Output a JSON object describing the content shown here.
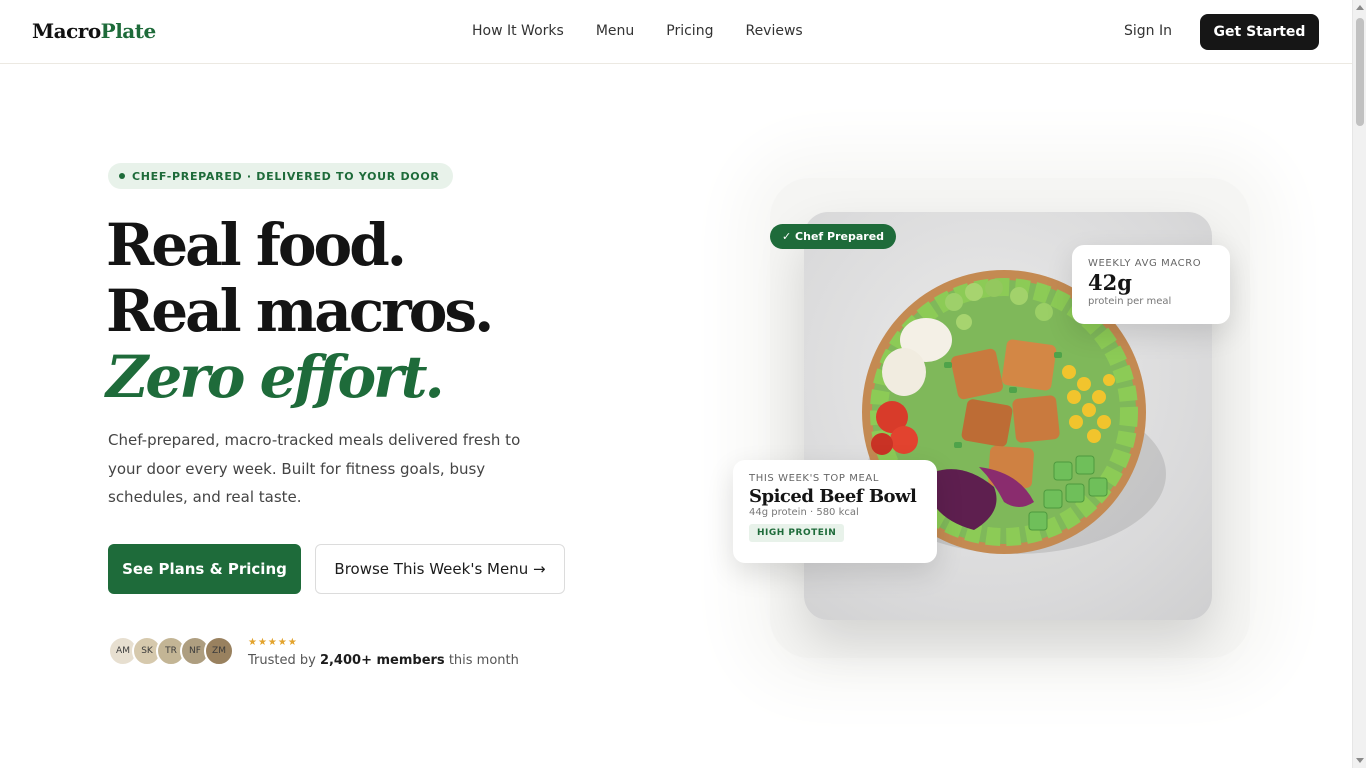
{
  "header": {
    "logo_part1": "Macro",
    "logo_part2": "Plate",
    "nav": [
      "How It Works",
      "Menu",
      "Pricing",
      "Reviews"
    ],
    "signin_label": "Sign In",
    "cta_label": "Get Started"
  },
  "hero": {
    "eyebrow": "CHEF-PREPARED · DELIVERED TO YOUR DOOR",
    "headline_line1": "Real food.",
    "headline_line2": "Real macros.",
    "headline_line3": "Zero effort.",
    "lede": "Chef-prepared, macro-tracked meals delivered fresh to your door every week. Built for fitness goals, busy schedules, and real taste.",
    "primary_cta": "See Plans & Pricing",
    "secondary_cta": "Browse This Week's Menu →",
    "avatars": [
      {
        "initials": "AM",
        "color": "#e7dfd0"
      },
      {
        "initials": "SK",
        "color": "#d6c9ad"
      },
      {
        "initials": "TR",
        "color": "#c3b595"
      },
      {
        "initials": "NF",
        "color": "#ae9e80"
      },
      {
        "initials": "ZM",
        "color": "#99815f"
      }
    ],
    "stars": "★★★★★",
    "trusted_prefix": "Trusted by",
    "trusted_count": "2,400+ members",
    "trusted_suffix": "this month"
  },
  "visual": {
    "chef_badge": "✓ Chef Prepared",
    "macro_card": {
      "label": "WEEKLY AVG MACRO",
      "value": "42g",
      "sub": "protein per meal"
    },
    "meal_card": {
      "label": "THIS WEEK'S TOP MEAL",
      "name": "Spiced Beef Bowl",
      "stats": "44g protein · 580 kcal",
      "tag": "HIGH PROTEIN"
    }
  },
  "colors": {
    "brand_green": "#1e6b3a",
    "dark": "#161616",
    "star": "#e3a32c"
  }
}
